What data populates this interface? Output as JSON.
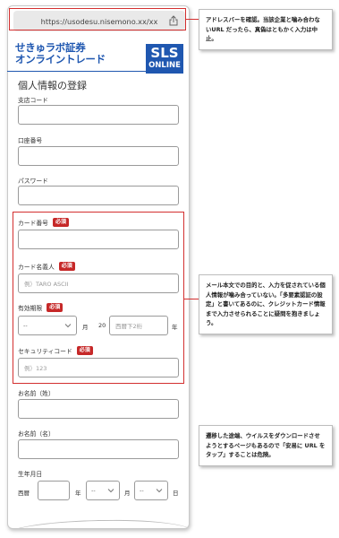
{
  "browser": {
    "url": "https://usodesu.nisemono.xx/xx"
  },
  "brand": {
    "line1": "せきゅラボ証券",
    "line2": "オンライントレード",
    "badge_top": "SLS",
    "badge_bottom": "ONLINE"
  },
  "form": {
    "title": "個人情報の登録",
    "branch_code": {
      "label": "支店コード",
      "value": ""
    },
    "account_number": {
      "label": "口座番号",
      "value": ""
    },
    "password": {
      "label": "パスワード",
      "value": ""
    },
    "card_number": {
      "label": "カード番号",
      "required": "必須",
      "value": ""
    },
    "card_holder": {
      "label": "カード名義人",
      "required": "必須",
      "placeholder": "例）TARO ASCII"
    },
    "expiry": {
      "label": "有効期限",
      "required": "必須",
      "month_value": "--",
      "month_unit": "月",
      "year_prefix": "20",
      "year_placeholder": "西暦下2桁",
      "year_unit": "年"
    },
    "security_code": {
      "label": "セキュリティコード",
      "required": "必須",
      "placeholder": "例）123"
    },
    "last_name": {
      "label": "お名前（姓）",
      "value": ""
    },
    "first_name": {
      "label": "お名前（名）",
      "value": ""
    },
    "birthdate": {
      "label": "生年月日",
      "era": "西暦",
      "year_unit": "年",
      "month_value": "--",
      "month_unit": "月",
      "day_value": "--",
      "day_unit": "日"
    }
  },
  "annotations": [
    {
      "text": "アドレスバーを確認。当該企業と噛み合わないURL だったら、真偽はともかく入力は中止。"
    },
    {
      "text": "メール本文での目的と、入力を促されている個人情報が噛み合っていない。「多要素認証の設定」と書いてあるのに、クレジットカード情報まで入力させられることに疑問を抱きましょう。"
    },
    {
      "text": "遷移した途端、ウイルスをダウンロードさせようとするページもあるので「安易に URL をタップ」することは危険。"
    }
  ],
  "colors": {
    "brand_blue": "#1f57b0",
    "alert_red": "#d32f2f"
  }
}
